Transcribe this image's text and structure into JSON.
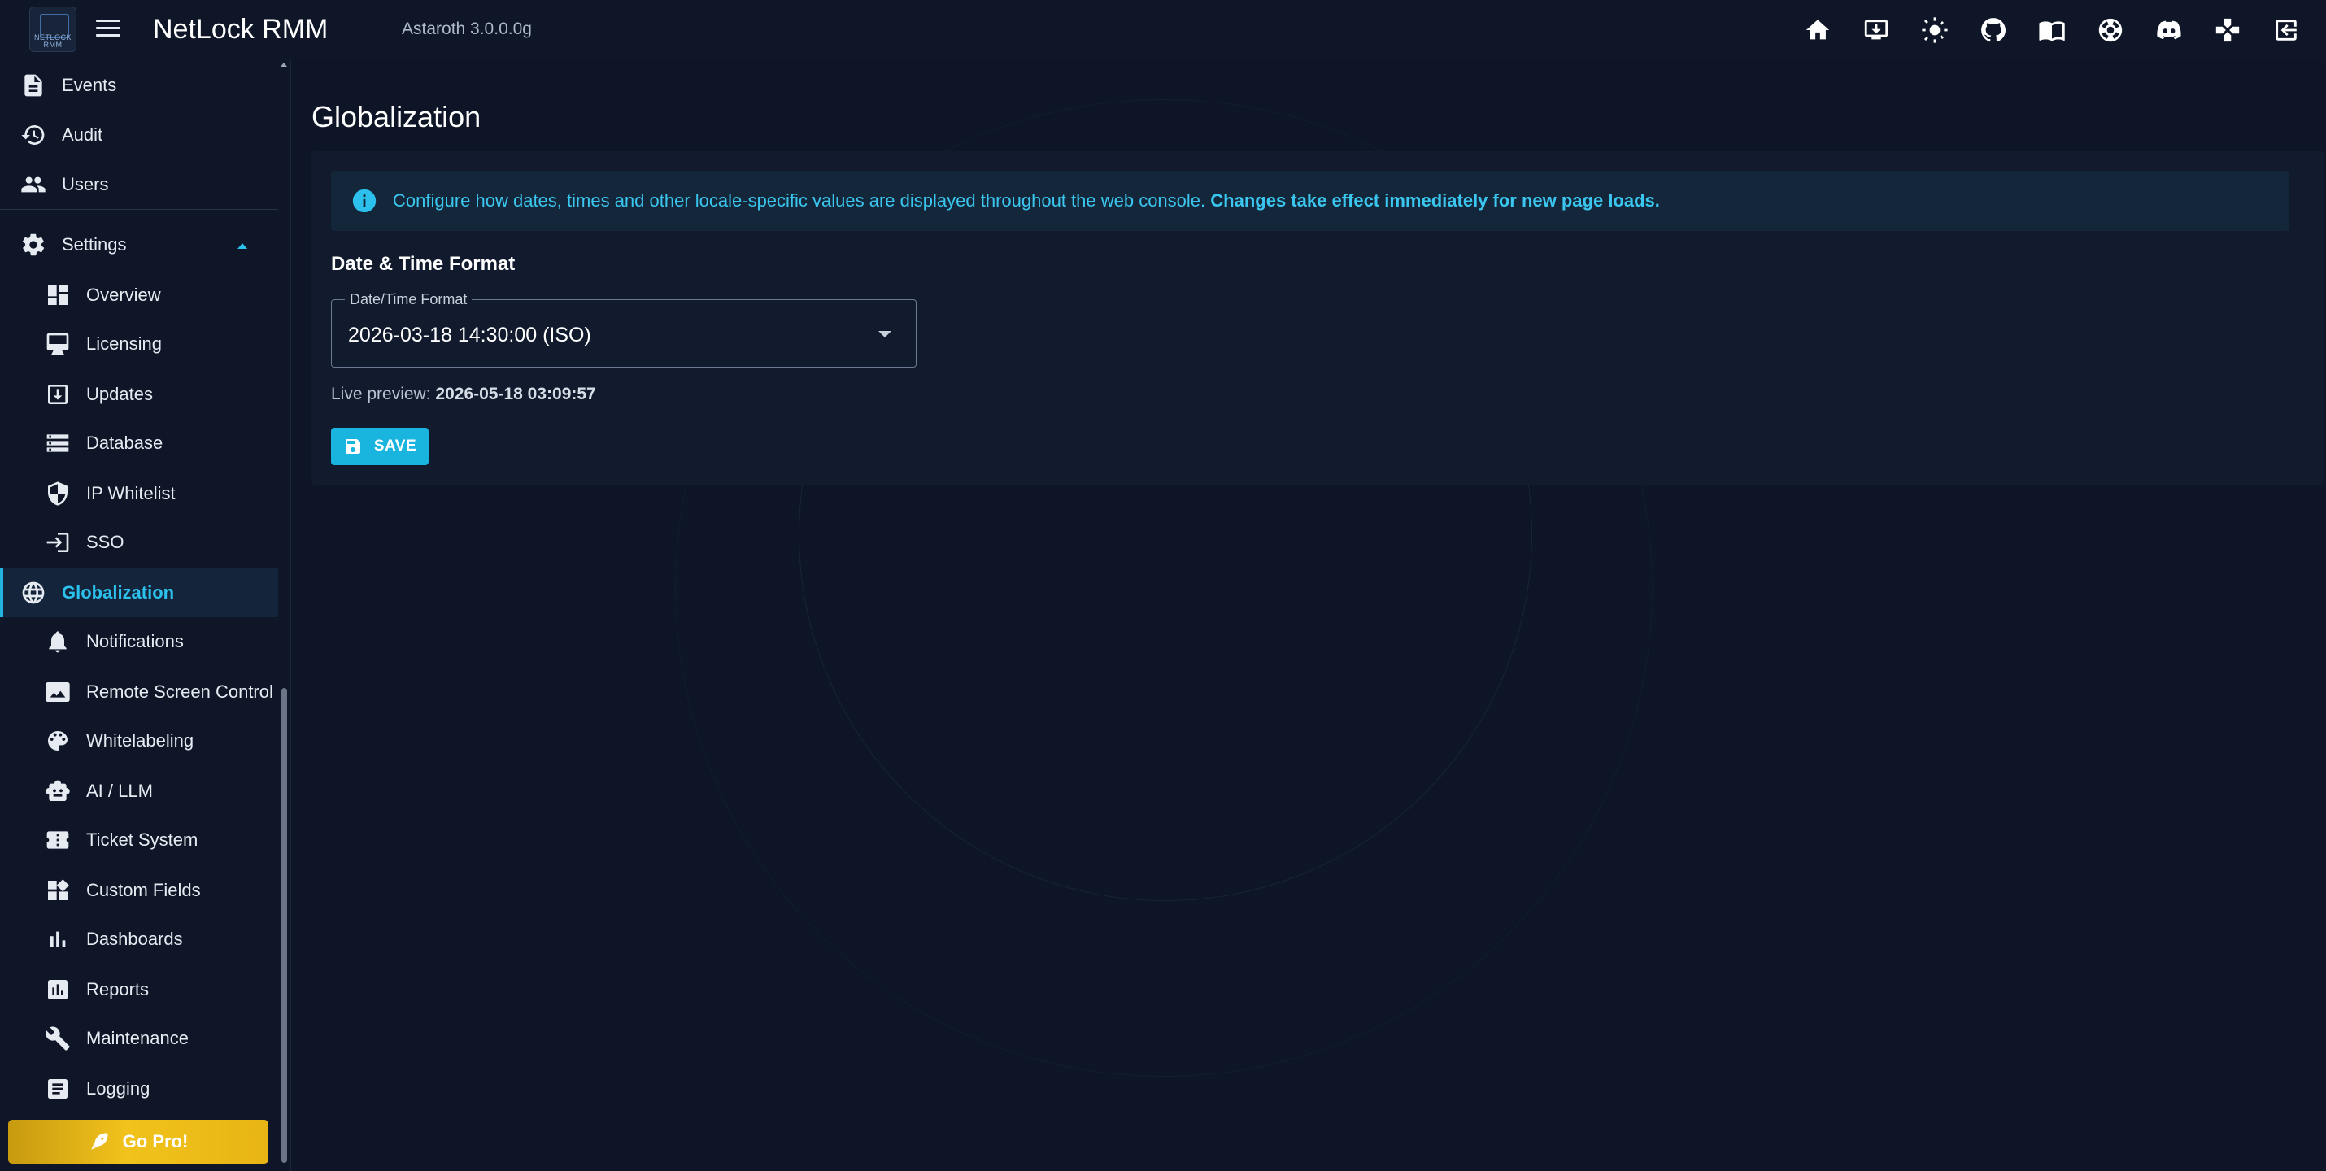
{
  "app": {
    "title": "NetLock RMM",
    "version": "Astaroth 3.0.0.0g",
    "logo_text": "NETLOCK RMM"
  },
  "header_icons": [
    "home-icon",
    "download-icon",
    "brightness-icon",
    "github-icon",
    "docs-icon",
    "support-icon",
    "discord-icon",
    "gamepad-icon",
    "logout-icon"
  ],
  "sidebar": {
    "top_items": [
      {
        "label": "Events",
        "icon": "events-icon"
      },
      {
        "label": "Audit",
        "icon": "history-icon"
      },
      {
        "label": "Users",
        "icon": "users-icon"
      }
    ],
    "settings": {
      "label": "Settings",
      "icon": "gear-icon",
      "expanded": true
    },
    "sub_items": [
      {
        "label": "Overview",
        "icon": "dashboard-icon"
      },
      {
        "label": "Licensing",
        "icon": "license-icon"
      },
      {
        "label": "Updates",
        "icon": "update-icon"
      },
      {
        "label": "Database",
        "icon": "database-icon"
      },
      {
        "label": "IP Whitelist",
        "icon": "shield-icon"
      },
      {
        "label": "SSO",
        "icon": "login-icon"
      },
      {
        "label": "Globalization",
        "icon": "globe-icon",
        "active": true
      },
      {
        "label": "Notifications",
        "icon": "bell-icon"
      },
      {
        "label": "Remote Screen Control",
        "icon": "screen-icon"
      },
      {
        "label": "Whitelabeling",
        "icon": "palette-icon"
      },
      {
        "label": "AI / LLM",
        "icon": "robot-icon"
      },
      {
        "label": "Ticket System",
        "icon": "ticket-icon"
      },
      {
        "label": "Custom Fields",
        "icon": "add-widget-icon"
      },
      {
        "label": "Dashboards",
        "icon": "bar-chart-icon"
      },
      {
        "label": "Reports",
        "icon": "report-icon"
      },
      {
        "label": "Maintenance",
        "icon": "wrench-icon"
      },
      {
        "label": "Logging",
        "icon": "log-icon"
      }
    ],
    "go_pro": "Go Pro!"
  },
  "main": {
    "page_title": "Globalization",
    "alert": {
      "text": "Configure how dates, times and other locale-specific values are displayed throughout the web console.",
      "bold": "Changes take effect immediately for new page loads."
    },
    "section_title": "Date & Time Format",
    "select": {
      "label": "Date/Time Format",
      "value": "2026-03-18 14:30:00 (ISO)"
    },
    "preview": {
      "label": "Live preview:",
      "value": "2026-05-18 03:09:57"
    },
    "save_label": "SAVE"
  },
  "colors": {
    "accent": "#1ab5df",
    "background": "#0d1526",
    "sidebar": "#0e1627",
    "gopro": "#f1c21b"
  }
}
